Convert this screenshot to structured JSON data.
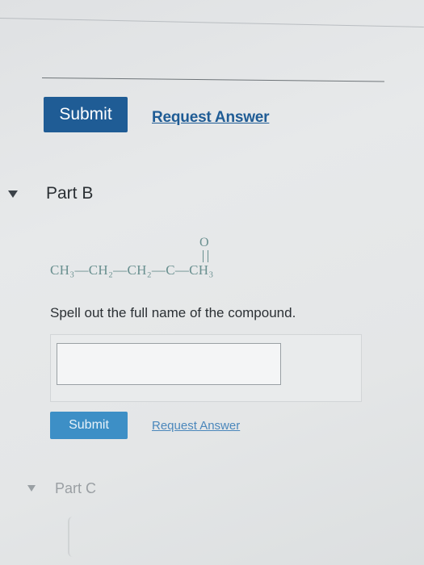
{
  "part_a": {
    "submit_label": "Submit",
    "request_answer_label": "Request Answer"
  },
  "part_b": {
    "title": "Part B",
    "formula": "CH₃—CH₂—CH₂—C—CH₃",
    "carbonyl_oxygen": "O",
    "question": "Spell out the full name of the compound.",
    "answer_value": "",
    "submit_label": "Submit",
    "request_answer_label": "Request Answer"
  },
  "part_c": {
    "title": "Part C"
  },
  "colors": {
    "primary_button": "#1f5c95",
    "secondary_button": "#3d8fc6",
    "link": "#1f5c95",
    "formula": "#6a9090"
  },
  "icons": {
    "expand": "caret-down-icon"
  }
}
